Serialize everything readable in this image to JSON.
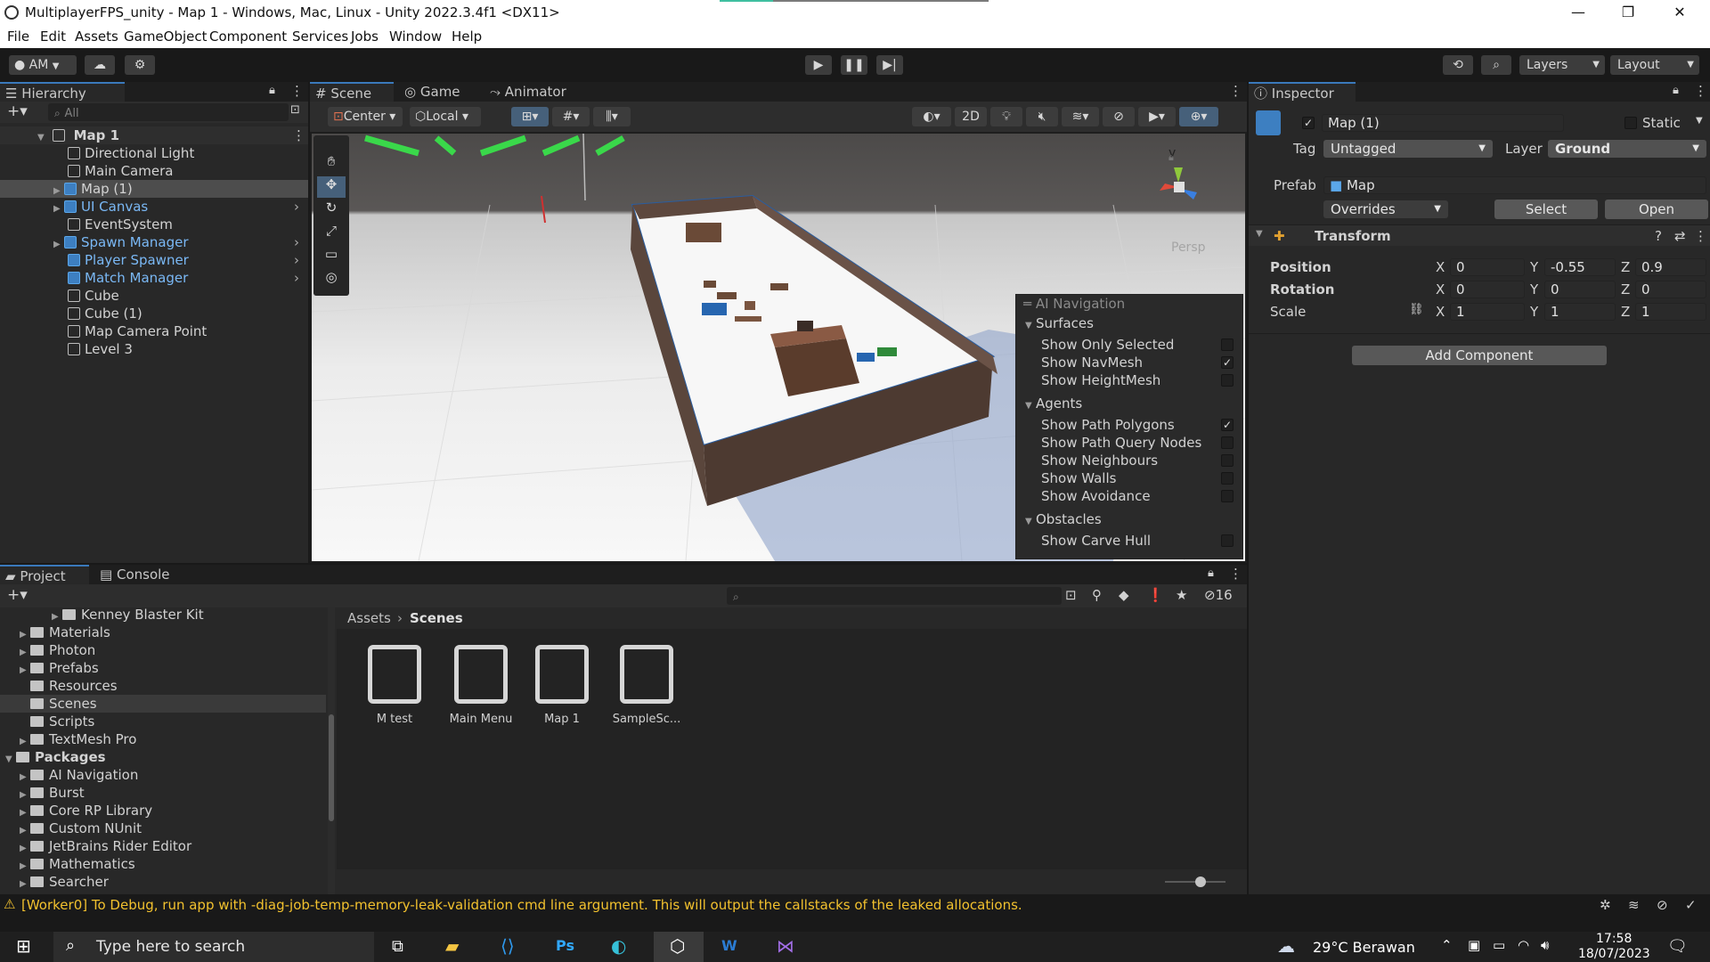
{
  "window": {
    "title": "MultiplayerFPS_unity - Map 1 - Windows, Mac, Linux - Unity 2022.3.4f1 <DX11>",
    "controls": [
      "—",
      "❐",
      "✕"
    ]
  },
  "menu": [
    "File",
    "Edit",
    "Assets",
    "GameObject",
    "Component",
    "Services",
    "Jobs",
    "Window",
    "Help"
  ],
  "toolbar": {
    "account": "AM",
    "layers": "Layers",
    "layout": "Layout"
  },
  "hierarchy": {
    "tab": "Hierarchy",
    "search_placeholder": "All",
    "scene": "Map 1",
    "items": [
      {
        "label": "Directional Light",
        "prefab": false
      },
      {
        "label": "Main Camera",
        "prefab": false
      },
      {
        "label": "Map (1)",
        "prefab": true,
        "selected": true
      },
      {
        "label": "UI Canvas",
        "prefab": true
      },
      {
        "label": "EventSystem",
        "prefab": false
      },
      {
        "label": "Spawn Manager",
        "prefab": true
      },
      {
        "label": "Player Spawner",
        "prefab": true
      },
      {
        "label": "Match Manager",
        "prefab": true
      },
      {
        "label": "Cube",
        "prefab": false
      },
      {
        "label": "Cube (1)",
        "prefab": false
      },
      {
        "label": "Map Camera Point",
        "prefab": false
      },
      {
        "label": "Level 3",
        "prefab": false
      }
    ]
  },
  "scene_tabs": [
    "Scene",
    "Game",
    "Animator"
  ],
  "scene_toolbar": {
    "pivot": "Center",
    "space": "Local",
    "mode_2d": "2D"
  },
  "scene": {
    "gizmo_axis": "y",
    "projection": "Persp"
  },
  "ai_navigation": {
    "title": "AI Navigation",
    "sections": [
      {
        "title": "Surfaces",
        "items": [
          {
            "label": "Show Only Selected",
            "checked": false
          },
          {
            "label": "Show NavMesh",
            "checked": true
          },
          {
            "label": "Show HeightMesh",
            "checked": false
          }
        ]
      },
      {
        "title": "Agents",
        "items": [
          {
            "label": "Show Path Polygons",
            "checked": true
          },
          {
            "label": "Show Path Query Nodes",
            "checked": false
          },
          {
            "label": "Show Neighbours",
            "checked": false
          },
          {
            "label": "Show Walls",
            "checked": false
          },
          {
            "label": "Show Avoidance",
            "checked": false
          }
        ]
      },
      {
        "title": "Obstacles",
        "items": [
          {
            "label": "Show Carve Hull",
            "checked": false
          }
        ]
      }
    ]
  },
  "inspector": {
    "tab": "Inspector",
    "object_name": "Map (1)",
    "static_label": "Static",
    "tag_label": "Tag",
    "tag_value": "Untagged",
    "layer_label": "Layer",
    "layer_value": "Ground",
    "prefab_label": "Prefab",
    "prefab_value": "Map",
    "overrides": "Overrides",
    "select": "Select",
    "open": "Open",
    "transform": {
      "title": "Transform",
      "position_label": "Position",
      "rotation_label": "Rotation",
      "scale_label": "Scale",
      "position": {
        "x": "0",
        "y": "-0.55",
        "z": "0.9"
      },
      "rotation": {
        "x": "0",
        "y": "0",
        "z": "0"
      },
      "scale": {
        "x": "1",
        "y": "1",
        "z": "1"
      }
    },
    "add_component": "Add Component"
  },
  "project": {
    "tabs": [
      "Project",
      "Console"
    ],
    "hidden_count": "16",
    "breadcrumb": [
      "Assets",
      "Scenes"
    ],
    "tree": [
      {
        "label": "Kenney Blaster Kit",
        "indent": 2
      },
      {
        "label": "Materials",
        "indent": 1
      },
      {
        "label": "Photon",
        "indent": 1
      },
      {
        "label": "Prefabs",
        "indent": 1
      },
      {
        "label": "Resources",
        "indent": 1
      },
      {
        "label": "Scenes",
        "indent": 1,
        "selected": true
      },
      {
        "label": "Scripts",
        "indent": 1
      },
      {
        "label": "TextMesh Pro",
        "indent": 1
      },
      {
        "label": "Packages",
        "indent": 0,
        "bold": true
      },
      {
        "label": "AI Navigation",
        "indent": 1
      },
      {
        "label": "Burst",
        "indent": 1
      },
      {
        "label": "Core RP Library",
        "indent": 1
      },
      {
        "label": "Custom NUnit",
        "indent": 1
      },
      {
        "label": "JetBrains Rider Editor",
        "indent": 1
      },
      {
        "label": "Mathematics",
        "indent": 1
      },
      {
        "label": "Searcher",
        "indent": 1
      }
    ],
    "assets": [
      "M test",
      "Main Menu",
      "Map 1",
      "SampleSc..."
    ]
  },
  "status": {
    "message": "[Worker0] To Debug, run app with -diag-job-temp-memory-leak-validation cmd line argument. This will output the callstacks of the leaked allocations."
  },
  "taskbar": {
    "search_placeholder": "Type here to search",
    "weather": "29°C  Berawan",
    "time": "17:58",
    "date": "18/07/2023"
  },
  "colors": {
    "accent": "#3a79bb",
    "selection": "#2c5d87",
    "warning": "#f2c12e"
  }
}
